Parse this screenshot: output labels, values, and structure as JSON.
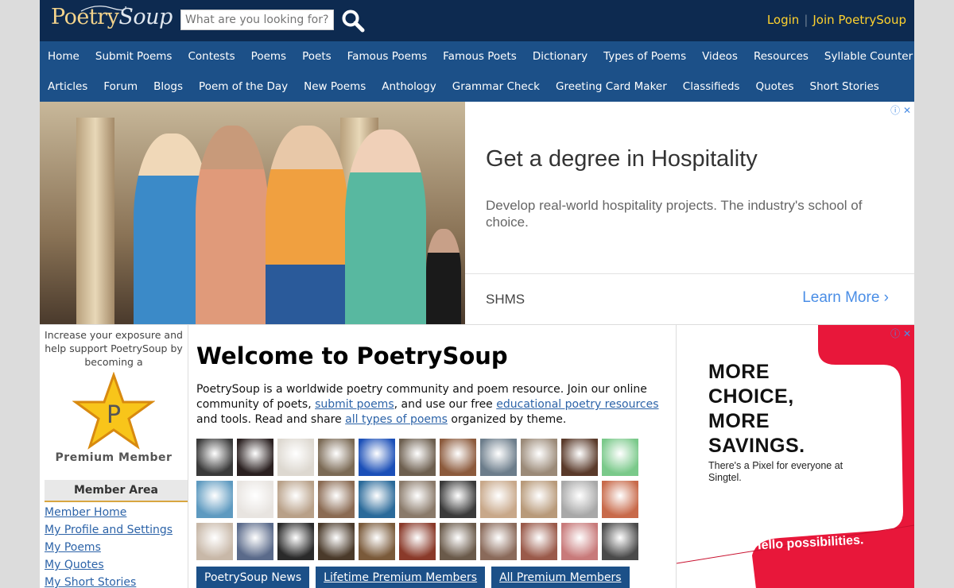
{
  "header": {
    "logo_part1": "Poetry",
    "logo_part2": "Soup",
    "search_placeholder": "What are you looking for?",
    "login": "Login",
    "separator": "|",
    "join": "Join PoetrySoup"
  },
  "nav": {
    "row1": [
      "Home",
      "Submit Poems",
      "Contests",
      "Poems",
      "Poets",
      "Famous Poems",
      "Famous Poets",
      "Dictionary",
      "Types of Poems",
      "Videos",
      "Resources",
      "Syllable Counter"
    ],
    "row2": [
      "Articles",
      "Forum",
      "Blogs",
      "Poem of the Day",
      "New Poems",
      "Anthology",
      "Grammar Check",
      "Greeting Card Maker",
      "Classifieds",
      "Quotes",
      "Short Stories"
    ]
  },
  "ad_banner": {
    "headline": "Get a degree in Hospitality",
    "body": "Develop real-world hospitality projects. The industry's school of choice.",
    "brand": "SHMS",
    "cta": "Learn More",
    "cta_arrow": "›",
    "close": "ⓘ ✕"
  },
  "sidebar": {
    "promo": "Increase your exposure and help support PoetrySoup by becoming a",
    "star_letter": "P",
    "premium": "Premium Member",
    "member_area": "Member Area",
    "links": [
      "Member Home",
      "My Profile and Settings",
      "My Poems",
      "My Quotes",
      "My Short Stories"
    ]
  },
  "main": {
    "title": "Welcome to PoetrySoup",
    "intro_1": "PoetrySoup is a worldwide poetry community and poem resource. Join our online community of poets, ",
    "link_submit": "submit poems",
    "intro_2": ", and use our free ",
    "link_resources": "educational poetry resources",
    "intro_3": " and tools. Read and share ",
    "link_types": "all types of poems",
    "intro_4": " organized by theme.",
    "avatar_colors": [
      "#3a3a3a",
      "#2a2020",
      "#ddd8d0",
      "#7b6a55",
      "#1b4fb8",
      "#6d5f4f",
      "#8c5a3c",
      "#6c7d8b",
      "#9b8a78",
      "#5a3a2a",
      "#7ac98a",
      "#5e9ac0",
      "#e8e4e0",
      "#b8a088",
      "#8a6a52",
      "#2a6a9a",
      "#8a7a6a",
      "#3a3a3a",
      "#c8a88a",
      "#b89a7a",
      "#a8a8a8",
      "#c86a4a",
      "#c8b8a8",
      "#5a6a8a",
      "#2a2a2a",
      "#4a3a2a",
      "#7a5a3a",
      "#8a3a2a",
      "#6a5a4a",
      "#8a6a5a",
      "#9a5a4a",
      "#c87a7a",
      "#4a4a4a"
    ],
    "buttons": [
      "PoetrySoup News",
      "Lifetime Premium Members",
      "All Premium Members"
    ]
  },
  "side_ad": {
    "headline_1": "MORE",
    "headline_2": "CHOICE,",
    "headline_3": "MORE",
    "headline_4": "SAVINGS.",
    "body": "There's a Pixel for everyone at Singtel.",
    "cta": "Hello possibilities.",
    "close": "ⓘ ✕",
    "accent": "#e8173a"
  }
}
